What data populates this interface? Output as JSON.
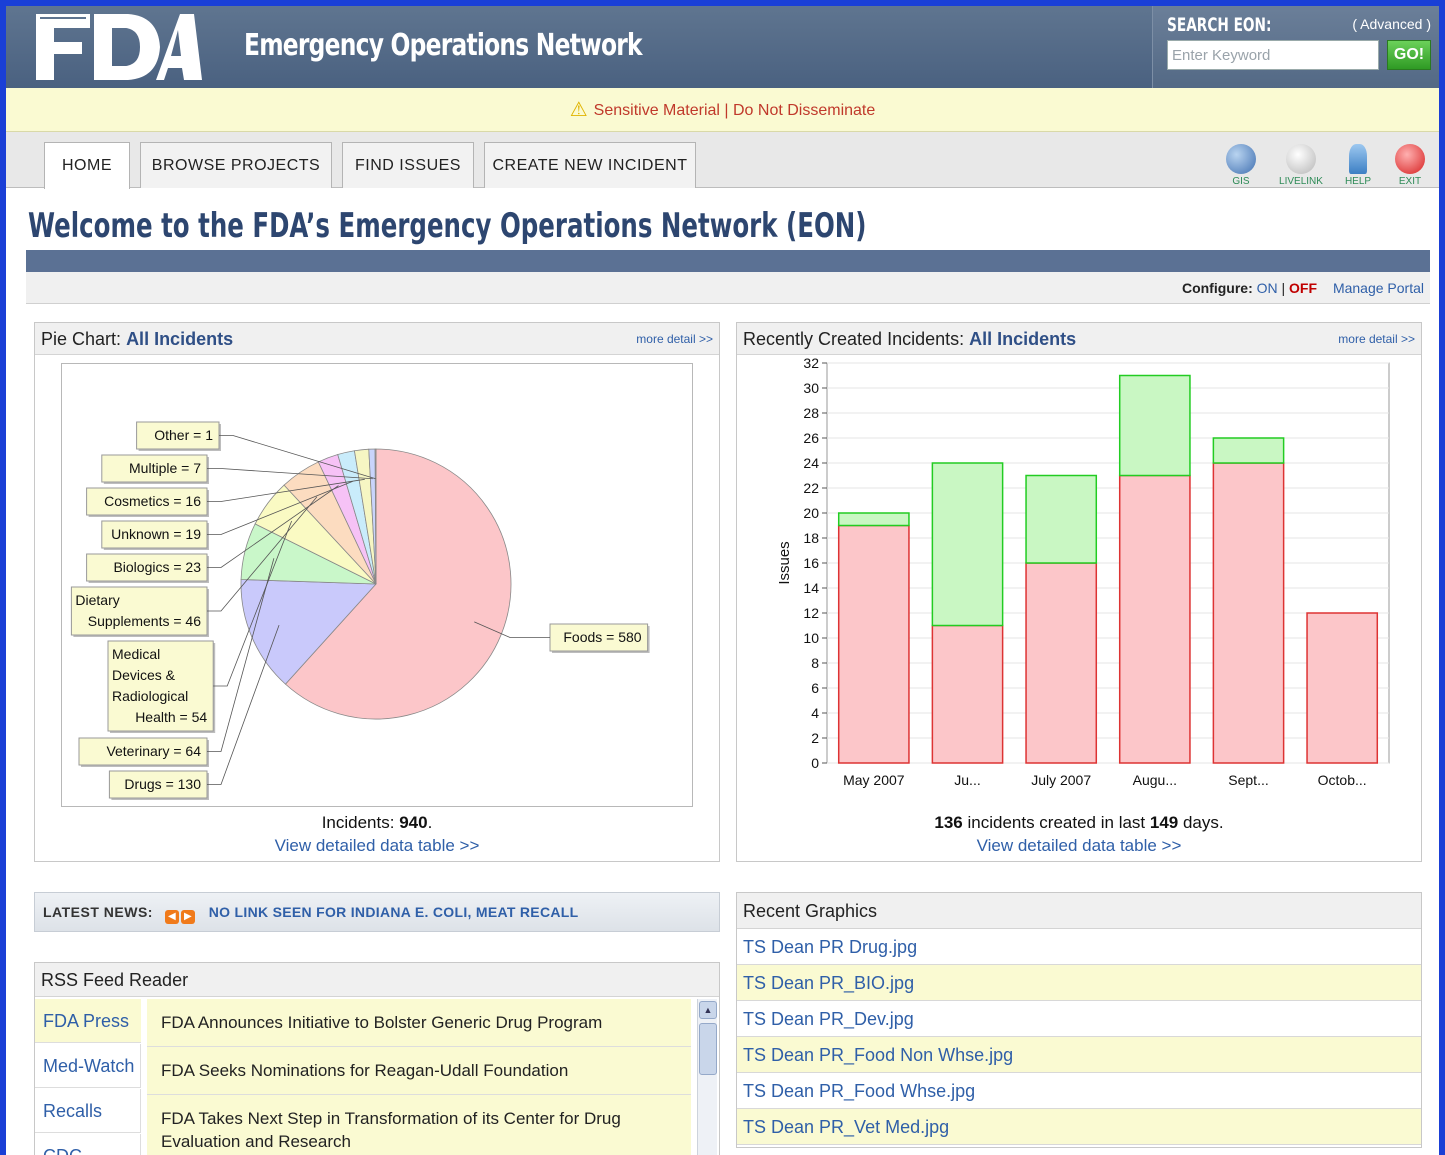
{
  "header": {
    "logo_text": "FDA",
    "title": "Emergency Operations Network",
    "search": {
      "label": "SEARCH EON:",
      "advanced": "( Advanced )",
      "placeholder": "Enter Keyword",
      "go": "GO!"
    }
  },
  "banner": {
    "text": "Sensitive Material | Do Not Disseminate"
  },
  "nav": {
    "tabs": [
      {
        "label": "HOME",
        "active": true
      },
      {
        "label": "BROWSE PROJECTS",
        "active": false
      },
      {
        "label": "FIND ISSUES",
        "active": false
      },
      {
        "label": "CREATE NEW INCIDENT",
        "active": false
      }
    ],
    "tools": [
      {
        "label": "GIS",
        "icon": "globe-icon"
      },
      {
        "label": "LIVELINK",
        "icon": "document-icon"
      },
      {
        "label": "HELP",
        "icon": "help-icon"
      },
      {
        "label": "EXIT",
        "icon": "exit-icon"
      }
    ]
  },
  "welcome": "Welcome to the FDA’s Emergency Operations Network (EON)",
  "configure": {
    "label": "Configure:",
    "on": "ON",
    "sep": "|",
    "off": "OFF",
    "manage": "Manage Portal"
  },
  "pie_panel": {
    "title_prefix": "Pie Chart:",
    "title_bold": "All Incidents",
    "more": "more detail >>",
    "total_label": "Incidents:",
    "total_value": "940",
    "total_suffix": ".",
    "link": "View detailed data table >>"
  },
  "bar_panel": {
    "title_prefix": "Recently Created Incidents:",
    "title_bold": "All Incidents",
    "more": "more detail >>",
    "summary_count": "136",
    "summary_mid": " incidents created in last ",
    "summary_days": "149",
    "summary_end": " days.",
    "link": "View detailed data table >>"
  },
  "chart_data": [
    {
      "type": "pie",
      "slices": [
        {
          "label": "Foods = 580",
          "value": 580,
          "color": "#fcc6c9"
        },
        {
          "label": "Drugs = 130",
          "value": 130,
          "color": "#c9c9fb"
        },
        {
          "label": "Veterinary = 64",
          "value": 64,
          "color": "#c9f7c9"
        },
        {
          "label": "Medical Devices & Radiological Health = 54",
          "value": 54,
          "color": "#fafac3"
        },
        {
          "label": "Dietary Supplements = 46",
          "value": 46,
          "color": "#fcdcc0"
        },
        {
          "label": "Biologics = 23",
          "value": 23,
          "color": "#f6c2f6"
        },
        {
          "label": "Unknown = 19",
          "value": 19,
          "color": "#c9ecfb"
        },
        {
          "label": "Cosmetics = 16",
          "value": 16,
          "color": "#f6f6c3"
        },
        {
          "label": "Multiple = 7",
          "value": 7,
          "color": "#c9d4fb"
        },
        {
          "label": "Other = 1",
          "value": 1,
          "color": "#fcd4d4"
        }
      ]
    },
    {
      "type": "bar",
      "categories": [
        "May 2007",
        "Ju...",
        "July 2007",
        "Augu...",
        "Sept...",
        "Octob..."
      ],
      "series": [
        {
          "values": [
            19,
            11,
            16,
            23,
            24,
            12
          ],
          "color": "#fcc6c9",
          "stroke": "#d33"
        },
        {
          "values": [
            1,
            13,
            7,
            8,
            2,
            0
          ],
          "color": "#c9f7c3",
          "stroke": "#2c2"
        }
      ],
      "ylabel": "Issues",
      "ylim": [
        0,
        32
      ],
      "yticks": [
        0,
        2,
        4,
        6,
        8,
        10,
        12,
        14,
        16,
        18,
        20,
        22,
        24,
        26,
        28,
        30,
        32
      ],
      "stacked": true,
      "grid": true
    }
  ],
  "pie_labels": [
    {
      "lines": [
        "Other = 1"
      ]
    },
    {
      "lines": [
        "Multiple = 7"
      ]
    },
    {
      "lines": [
        "Cosmetics = 16"
      ]
    },
    {
      "lines": [
        "Unknown = 19"
      ]
    },
    {
      "lines": [
        "Biologics = 23"
      ]
    },
    {
      "lines": [
        "Dietary",
        "Supplements = 46"
      ]
    },
    {
      "lines": [
        "Medical",
        "Devices &",
        "Radiological",
        "Health = 54"
      ]
    },
    {
      "lines": [
        "Veterinary = 64"
      ]
    },
    {
      "lines": [
        "Drugs = 130"
      ]
    },
    {
      "lines": [
        "Foods = 580"
      ]
    }
  ],
  "news": {
    "label": "LATEST NEWS:",
    "headline": "NO LINK SEEN FOR INDIANA E. COLI, MEAT RECALL"
  },
  "rss": {
    "title": "RSS Feed Reader",
    "tabs": [
      "FDA Press",
      "Med-Watch",
      "Recalls",
      "CDC"
    ],
    "items": [
      "FDA Announces Initiative to Bolster Generic Drug Program",
      "FDA Seeks Nominations for Reagan-Udall Foundation",
      "FDA Takes Next Step in Transformation of its Center for Drug Evaluation and Research"
    ]
  },
  "graphics": {
    "title": "Recent Graphics",
    "items": [
      "TS Dean PR Drug.jpg",
      "TS Dean PR_BIO.jpg",
      "TS Dean PR_Dev.jpg",
      "TS Dean PR_Food Non Whse.jpg",
      "TS Dean PR_Food Whse.jpg",
      "TS Dean PR_Vet Med.jpg"
    ]
  }
}
